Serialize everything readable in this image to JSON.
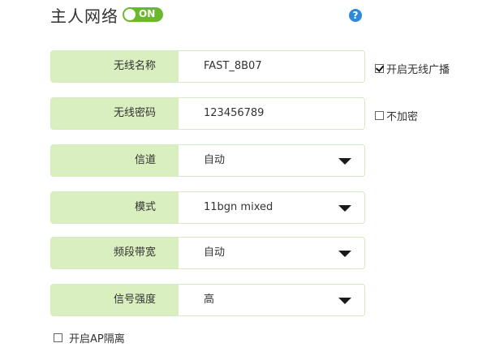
{
  "header": {
    "title": "主人网络",
    "toggle_state": "ON",
    "help_symbol": "?"
  },
  "fields": [
    {
      "label": "无线名称",
      "value": "FAST_8B07",
      "type": "input"
    },
    {
      "label": "无线密码",
      "value": "123456789",
      "type": "input"
    },
    {
      "label": "信道",
      "value": "自动",
      "type": "select"
    },
    {
      "label": "模式",
      "value": "11bgn mixed",
      "type": "select"
    },
    {
      "label": "频段带宽",
      "value": "自动",
      "type": "select"
    },
    {
      "label": "信号强度",
      "value": "高",
      "type": "select"
    }
  ],
  "options": {
    "broadcast_label": "开启无线广播",
    "broadcast_checked": true,
    "no_encrypt_label": "不加密",
    "no_encrypt_checked": false,
    "ap_isolation_label": "开启AP隔离",
    "ap_isolation_checked": false
  },
  "colors": {
    "accent_green": "#6ab82d",
    "label_bg": "#d9efbf",
    "help_blue": "#2e8ad8"
  },
  "icons": {
    "help": "help-icon",
    "dropdown": "chevron-down-icon"
  }
}
